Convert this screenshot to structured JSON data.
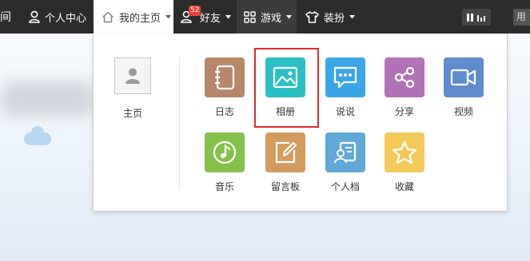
{
  "topbar": {
    "left_fragment": "间",
    "personal_center": "个人中心",
    "my_home": "我的主页",
    "friends": "好友",
    "friends_badge": "52",
    "games": "游戏",
    "dressup": "装扮",
    "right_label": "用"
  },
  "home": {
    "label": "主页"
  },
  "apps": [
    {
      "label": "日志",
      "icon": "diary-icon",
      "color": "#b8876a"
    },
    {
      "label": "相册",
      "icon": "photo-album-icon",
      "color": "#2bbfc3"
    },
    {
      "label": "说说",
      "icon": "speech-bubble-icon",
      "color": "#3aa6e8"
    },
    {
      "label": "分享",
      "icon": "share-icon",
      "color": "#b273b6"
    },
    {
      "label": "视频",
      "icon": "video-camera-icon",
      "color": "#5f8ccc"
    },
    {
      "label": "音乐",
      "icon": "music-note-icon",
      "color": "#84c14a"
    },
    {
      "label": "留言板",
      "icon": "edit-note-icon",
      "color": "#d49b5d"
    },
    {
      "label": "个人档",
      "icon": "profile-card-icon",
      "color": "#5fa9d6"
    },
    {
      "label": "收藏",
      "icon": "star-icon",
      "color": "#f3c95a"
    }
  ],
  "highlighted_app": "相册"
}
